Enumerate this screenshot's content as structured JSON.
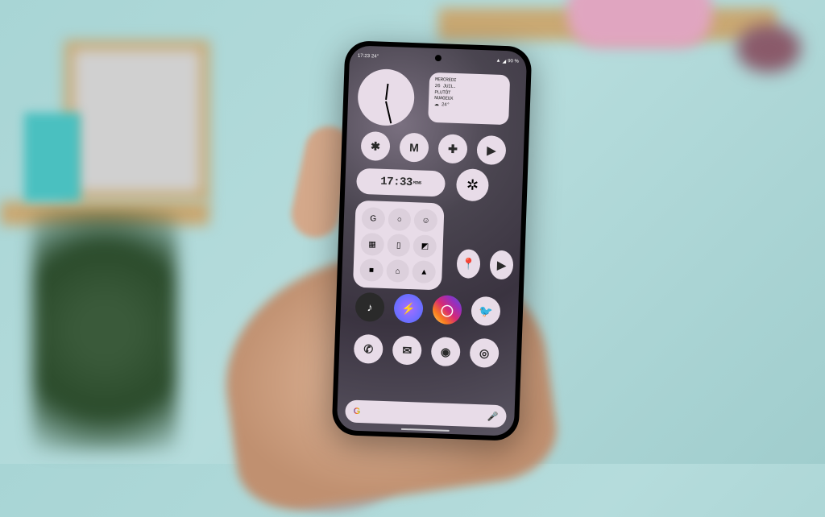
{
  "status_bar": {
    "time": "17:23",
    "temp": "24°",
    "battery": "90 %"
  },
  "widgets": {
    "weather": {
      "day": "MERCREDI",
      "date": "26 JUIL.",
      "condition1": "PLUTÔT",
      "condition2": "NUAGEUX",
      "temp": "24°"
    },
    "digital_time": "17:33",
    "digital_time_suffix": "MINS"
  },
  "apps": {
    "row1": [
      "slack",
      "gmail",
      "health",
      "play-store"
    ],
    "row2": [
      "fan"
    ],
    "folder": [
      "google",
      "circle",
      "user",
      "grid",
      "file",
      "gallery",
      "square",
      "home",
      "up"
    ],
    "rowA": [
      "maps",
      "youtube"
    ],
    "rowB": [
      "tiktok",
      "messenger",
      "instagram",
      "twitter"
    ],
    "rowC": [
      "phone",
      "messages",
      "chrome",
      "camera"
    ]
  },
  "search": {
    "logo": "G",
    "mic": "mic"
  }
}
